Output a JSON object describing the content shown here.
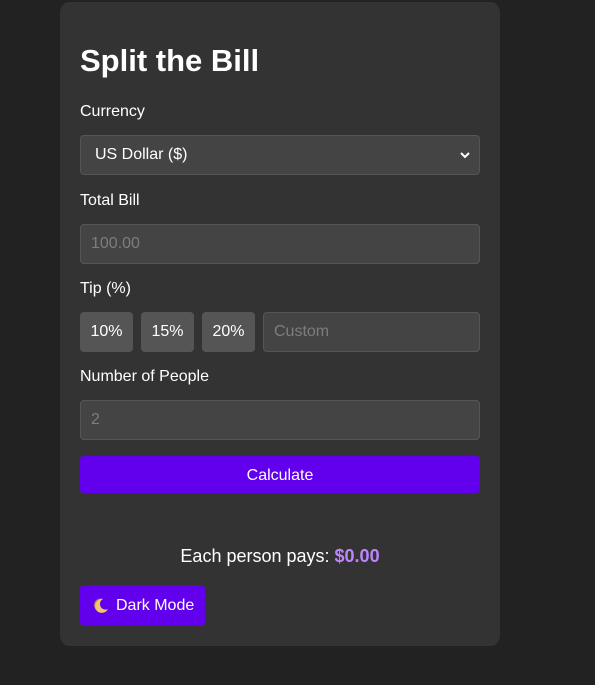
{
  "app": {
    "title": "Split the Bill"
  },
  "currency": {
    "label": "Currency",
    "selected": "US Dollar ($)"
  },
  "bill": {
    "label": "Total Bill",
    "placeholder": "100.00"
  },
  "tip": {
    "label": "Tip (%)",
    "options": [
      "10%",
      "15%",
      "20%"
    ],
    "custom_placeholder": "Custom"
  },
  "people": {
    "label": "Number of People",
    "placeholder": "2"
  },
  "actions": {
    "calculate_label": "Calculate",
    "dark_mode_label": "Dark Mode",
    "dark_mode_icon": "moon-icon"
  },
  "result": {
    "prefix": "Each person pays:",
    "amount": "$0.00"
  },
  "colors": {
    "background": "#222222",
    "card": "#333333",
    "input": "#444444",
    "tip_button": "#555555",
    "accent": "#6200ee",
    "amount": "#bb86fc"
  }
}
